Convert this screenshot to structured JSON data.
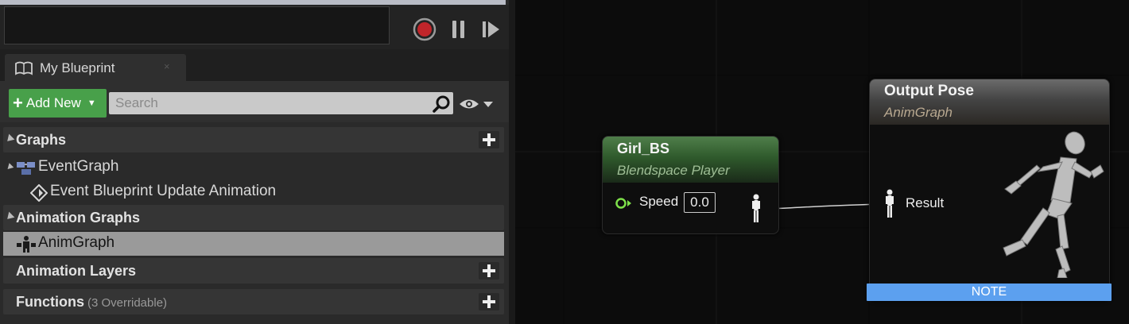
{
  "tab": {
    "label": "My Blueprint",
    "close": "×"
  },
  "toolbar": {
    "add_new_label": "Add New",
    "search_placeholder": "Search"
  },
  "sections": {
    "graphs": "Graphs",
    "animation_graphs": "Animation Graphs",
    "animation_layers": "Animation Layers",
    "functions": "Functions",
    "functions_sub": "(3 Overridable)"
  },
  "tree": {
    "event_graph": "EventGraph",
    "event_bp_update": "Event Blueprint Update Animation",
    "anim_graph": "AnimGraph"
  },
  "nodes": {
    "blendspace": {
      "title": "Girl_BS",
      "subtitle": "Blendspace Player",
      "pin_label": "Speed",
      "pin_value": "0.0"
    },
    "output": {
      "title": "Output Pose",
      "subtitle": "AnimGraph",
      "pin_label": "Result",
      "note": "NOTE"
    }
  },
  "colors": {
    "accent_green": "#48a04a",
    "note_blue": "#5ca0ef",
    "record_red": "#c0252a",
    "pin_green": "#7ee04a"
  }
}
